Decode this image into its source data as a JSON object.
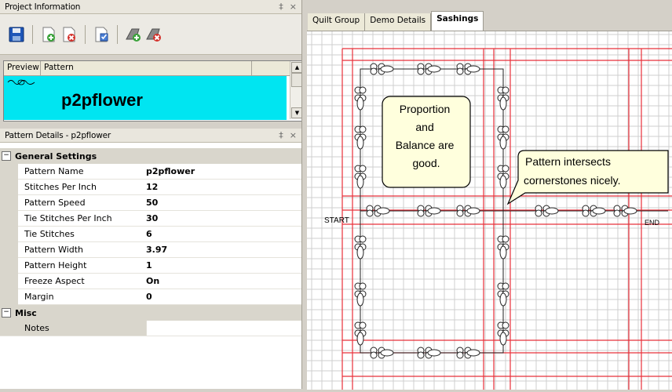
{
  "project_panel": {
    "title": "Project Information",
    "pin": "‡",
    "close": "×"
  },
  "toolbar": {
    "buttons": [
      "save",
      "add-pattern",
      "remove-pattern",
      "edit-pattern",
      "add-group",
      "remove-group"
    ]
  },
  "pattern_list": {
    "columns": [
      "Preview",
      "Pattern"
    ],
    "selected_pattern": "p2pflower"
  },
  "details_panel": {
    "title": "Pattern Details - p2pflower",
    "pin": "‡",
    "close": "×"
  },
  "general": {
    "section_label": "General Settings",
    "toggle": "−",
    "rows": [
      {
        "name": "Pattern Name",
        "value": "p2pflower"
      },
      {
        "name": "Stitches Per Inch",
        "value": "12"
      },
      {
        "name": "Pattern Speed",
        "value": "50"
      },
      {
        "name": "Tie Stitches Per Inch",
        "value": "30"
      },
      {
        "name": "Tie Stitches",
        "value": "6"
      },
      {
        "name": "Pattern Width",
        "value": "3.97"
      },
      {
        "name": "Pattern Height",
        "value": "1"
      },
      {
        "name": "Freeze Aspect",
        "value": "On"
      },
      {
        "name": "Margin",
        "value": "0"
      }
    ]
  },
  "misc": {
    "section_label": "Misc",
    "toggle": "−",
    "rows": [
      {
        "name": "Notes",
        "value": ""
      }
    ]
  },
  "tabs": [
    {
      "label": "Quilt Group",
      "active": false
    },
    {
      "label": "Demo Details",
      "active": false
    },
    {
      "label": "Sashings",
      "active": true
    }
  ],
  "canvas": {
    "callout1": [
      "Proportion",
      "and",
      "Balance are",
      "good."
    ],
    "callout2": [
      "Pattern intersects",
      "cornerstones nicely."
    ],
    "start_label": "START",
    "end_label": "END"
  },
  "colors": {
    "selection": "#00e5f1",
    "grid_major": "#e8303a",
    "grid_minor": "#cfcfcf",
    "callout_bg": "#ffffdd"
  }
}
